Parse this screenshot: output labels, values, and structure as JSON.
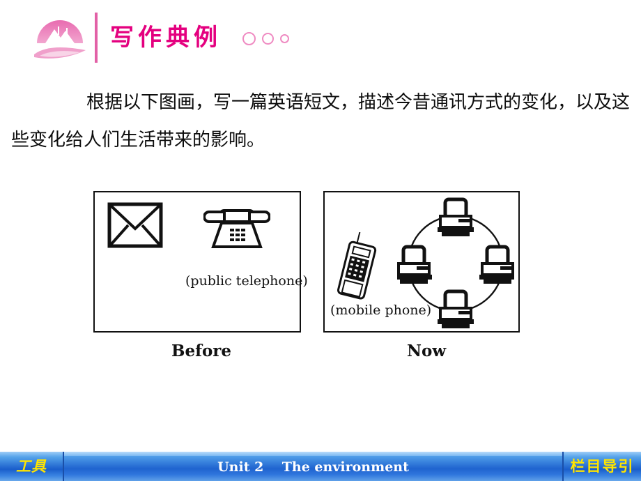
{
  "header": {
    "title": "写作典例",
    "logo_name": "sunrise-mountain-logo",
    "accent_color": "#e4007f",
    "divider_color": "#e260a6",
    "dot_color": "#ef8bc2"
  },
  "prompt": {
    "text": "根据以下图画，写一篇英语短文，描述今昔通讯方式的变化，以及这些变化给人们生活带来的影响。"
  },
  "figure": {
    "before": {
      "caption": "Before",
      "icons": [
        "envelope",
        "desk-telephone"
      ],
      "label": "(public telephone)"
    },
    "now": {
      "caption": "Now",
      "icons": [
        "mobile-phone",
        "computer-network-ring"
      ],
      "label": "(mobile phone)",
      "computer_count": 4
    }
  },
  "footer": {
    "left_label": "工具",
    "center_label": "Unit 2    The environment",
    "right_label": "栏目导引",
    "bar_color": "#1f63cf",
    "text_color": "#ffe400"
  }
}
